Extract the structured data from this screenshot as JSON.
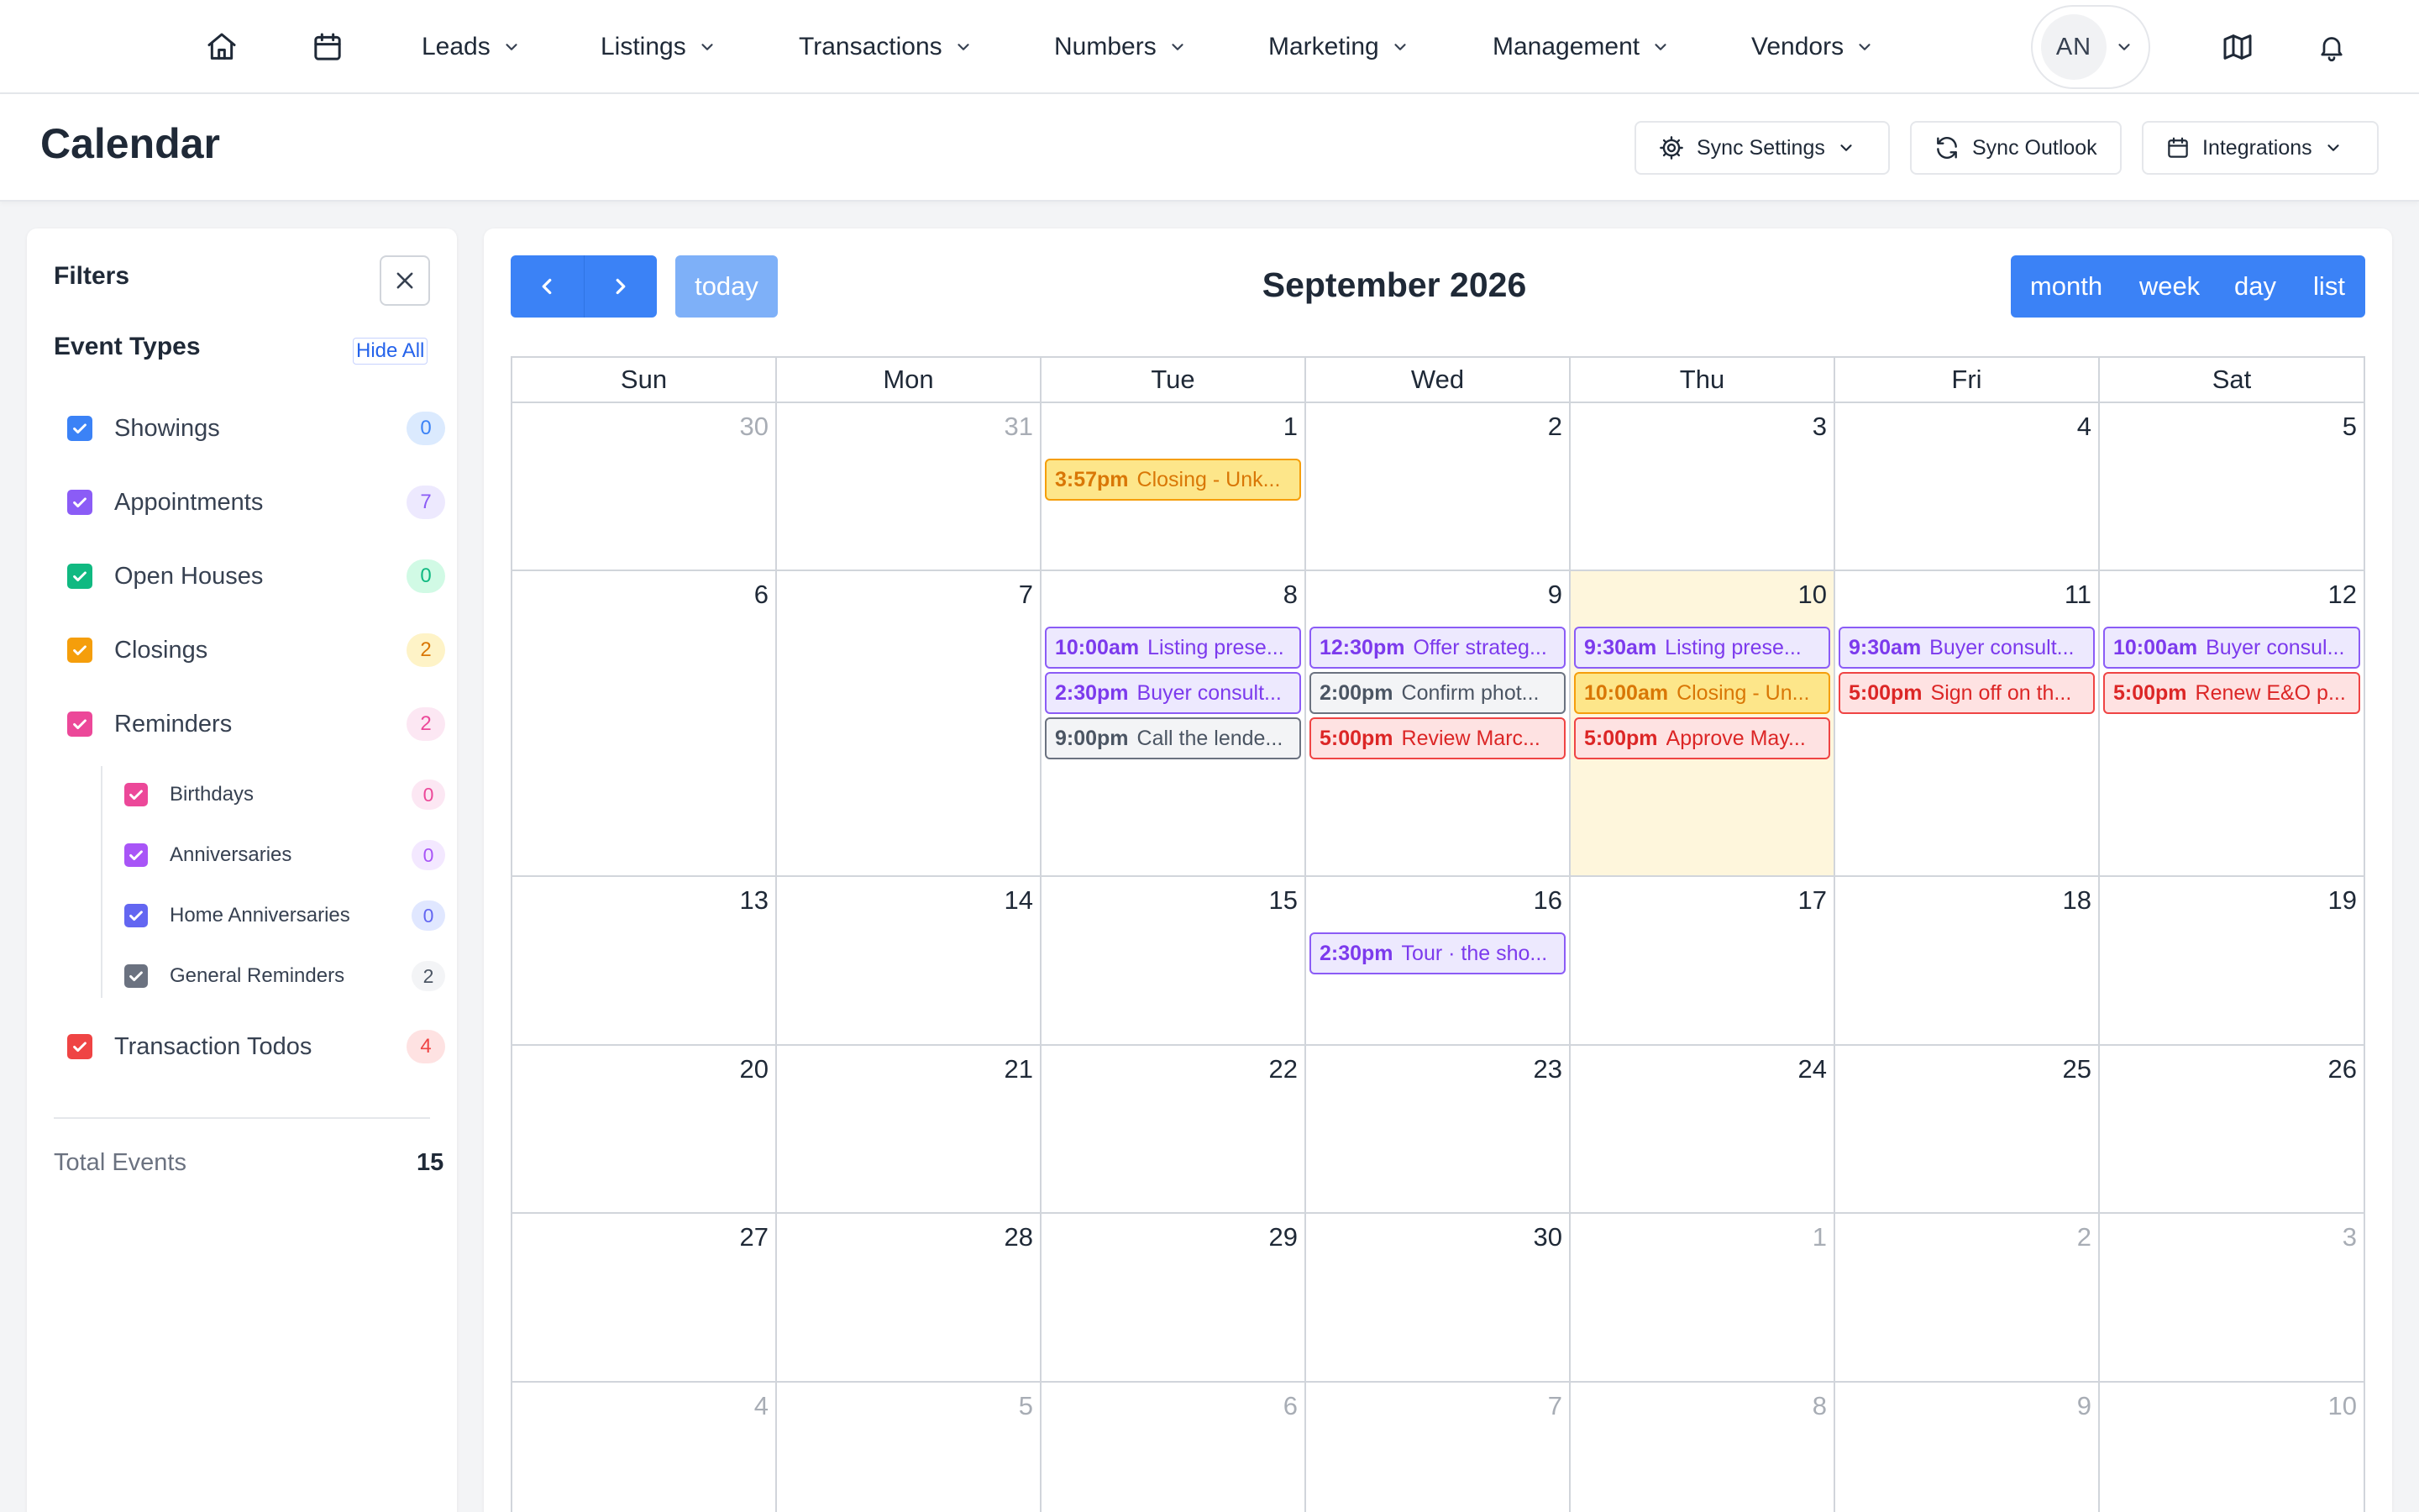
{
  "nav": {
    "menus": [
      {
        "label": "Leads",
        "name": "nav-leads"
      },
      {
        "label": "Listings",
        "name": "nav-listings"
      },
      {
        "label": "Transactions",
        "name": "nav-transactions"
      },
      {
        "label": "Numbers",
        "name": "nav-numbers"
      },
      {
        "label": "Marketing",
        "name": "nav-marketing"
      },
      {
        "label": "Management",
        "name": "nav-management"
      },
      {
        "label": "Vendors",
        "name": "nav-vendors"
      }
    ],
    "avatar_initials": "AN",
    "icons": [
      "home-icon",
      "calendar-icon",
      "map-icon",
      "bell-icon"
    ]
  },
  "header": {
    "title": "Calendar",
    "buttons": {
      "sync_settings": "Sync Settings",
      "sync_outlook": "Sync Outlook",
      "integrations": "Integrations"
    }
  },
  "filters": {
    "title": "Filters",
    "event_types_title": "Event Types",
    "hide_all": "Hide All",
    "types": [
      {
        "label": "Showings",
        "count": "0",
        "color": "#3b82f6",
        "badge_bg": "#dbeafe",
        "badge_fg": "#3b82f6"
      },
      {
        "label": "Appointments",
        "count": "7",
        "color": "#8b5cf6",
        "badge_bg": "#ede9fe",
        "badge_fg": "#8b5cf6"
      },
      {
        "label": "Open Houses",
        "count": "0",
        "color": "#10b981",
        "badge_bg": "#d1fae5",
        "badge_fg": "#10b981"
      },
      {
        "label": "Closings",
        "count": "2",
        "color": "#f59e0b",
        "badge_bg": "#fef3c7",
        "badge_fg": "#d97706"
      },
      {
        "label": "Reminders",
        "count": "2",
        "color": "#ec4899",
        "badge_bg": "#fce7f3",
        "badge_fg": "#ec4899"
      }
    ],
    "reminder_subtypes": [
      {
        "label": "Birthdays",
        "count": "0",
        "color": "#ec4899",
        "badge_bg": "#fce7f3",
        "badge_fg": "#ec4899"
      },
      {
        "label": "Anniversaries",
        "count": "0",
        "color": "#a855f7",
        "badge_bg": "#f3e8ff",
        "badge_fg": "#a855f7"
      },
      {
        "label": "Home Anniversaries",
        "count": "0",
        "color": "#6366f1",
        "badge_bg": "#e0e7ff",
        "badge_fg": "#6366f1"
      },
      {
        "label": "General Reminders",
        "count": "2",
        "color": "#6b7280",
        "badge_bg": "#f3f4f6",
        "badge_fg": "#4b5563"
      }
    ],
    "todos": {
      "label": "Transaction Todos",
      "count": "4",
      "color": "#ef4444",
      "badge_bg": "#fee2e2",
      "badge_fg": "#ef4444"
    },
    "total_label": "Total Events",
    "total_value": "15"
  },
  "calendar": {
    "month_title": "September 2026",
    "today_label": "today",
    "views": [
      "month",
      "week",
      "day",
      "list"
    ],
    "active_view": "month",
    "weekdays": [
      "Sun",
      "Mon",
      "Tue",
      "Wed",
      "Thu",
      "Fri",
      "Sat"
    ],
    "weeks": [
      [
        {
          "day": "30",
          "other": true
        },
        {
          "day": "31",
          "other": true
        },
        {
          "day": "1",
          "events": [
            {
              "time": "3:57pm",
              "title": "Closing - Unk...",
              "kind": "closing"
            }
          ]
        },
        {
          "day": "2"
        },
        {
          "day": "3"
        },
        {
          "day": "4"
        },
        {
          "day": "5"
        }
      ],
      [
        {
          "day": "6"
        },
        {
          "day": "7"
        },
        {
          "day": "8",
          "events": [
            {
              "time": "10:00am",
              "title": "Listing prese...",
              "kind": "appointment"
            },
            {
              "time": "2:30pm",
              "title": "Buyer consult...",
              "kind": "appointment"
            },
            {
              "time": "9:00pm",
              "title": "Call the lende...",
              "kind": "general"
            }
          ]
        },
        {
          "day": "9",
          "events": [
            {
              "time": "12:30pm",
              "title": "Offer strateg...",
              "kind": "appointment"
            },
            {
              "time": "2:00pm",
              "title": "Confirm phot...",
              "kind": "general"
            },
            {
              "time": "5:00pm",
              "title": "Review Marc...",
              "kind": "todo"
            }
          ]
        },
        {
          "day": "10",
          "today": true,
          "events": [
            {
              "time": "9:30am",
              "title": "Listing prese...",
              "kind": "appointment"
            },
            {
              "time": "10:00am",
              "title": "Closing - Un...",
              "kind": "closing"
            },
            {
              "time": "5:00pm",
              "title": "Approve May...",
              "kind": "todo"
            }
          ]
        },
        {
          "day": "11",
          "events": [
            {
              "time": "9:30am",
              "title": "Buyer consult...",
              "kind": "appointment"
            },
            {
              "time": "5:00pm",
              "title": "Sign off on th...",
              "kind": "todo"
            }
          ]
        },
        {
          "day": "12",
          "events": [
            {
              "time": "10:00am",
              "title": "Buyer consul...",
              "kind": "appointment"
            },
            {
              "time": "5:00pm",
              "title": "Renew E&O p...",
              "kind": "todo"
            }
          ]
        }
      ],
      [
        {
          "day": "13"
        },
        {
          "day": "14"
        },
        {
          "day": "15"
        },
        {
          "day": "16",
          "events": [
            {
              "time": "2:30pm",
              "title": "Tour · the sho...",
              "kind": "appointment"
            }
          ]
        },
        {
          "day": "17"
        },
        {
          "day": "18"
        },
        {
          "day": "19"
        }
      ],
      [
        {
          "day": "20"
        },
        {
          "day": "21"
        },
        {
          "day": "22"
        },
        {
          "day": "23"
        },
        {
          "day": "24"
        },
        {
          "day": "25"
        },
        {
          "day": "26"
        }
      ],
      [
        {
          "day": "27"
        },
        {
          "day": "28"
        },
        {
          "day": "29"
        },
        {
          "day": "30"
        },
        {
          "day": "1",
          "other": true
        },
        {
          "day": "2",
          "other": true
        },
        {
          "day": "3",
          "other": true
        }
      ],
      [
        {
          "day": "4",
          "other": true
        },
        {
          "day": "5",
          "other": true
        },
        {
          "day": "6",
          "other": true
        },
        {
          "day": "7",
          "other": true
        },
        {
          "day": "8",
          "other": true
        },
        {
          "day": "9",
          "other": true
        },
        {
          "day": "10",
          "other": true
        }
      ]
    ],
    "event_styles": {
      "closing": {
        "bg": "#fde68a",
        "border": "#f59e0b",
        "time": "#d97706",
        "text": "#d97706"
      },
      "appointment": {
        "bg": "#ede9fe",
        "border": "#8b5cf6",
        "time": "#7c3aed",
        "text": "#7c3aed"
      },
      "general": {
        "bg": "#f3f4f6",
        "border": "#6b7280",
        "time": "#4b5563",
        "text": "#4b5563"
      },
      "todo": {
        "bg": "#fee2e2",
        "border": "#ef4444",
        "time": "#dc2626",
        "text": "#dc2626"
      }
    },
    "today_bg": "#fef6dc",
    "accent": "#3b82f6",
    "accent_active": "#1d4ed8"
  }
}
